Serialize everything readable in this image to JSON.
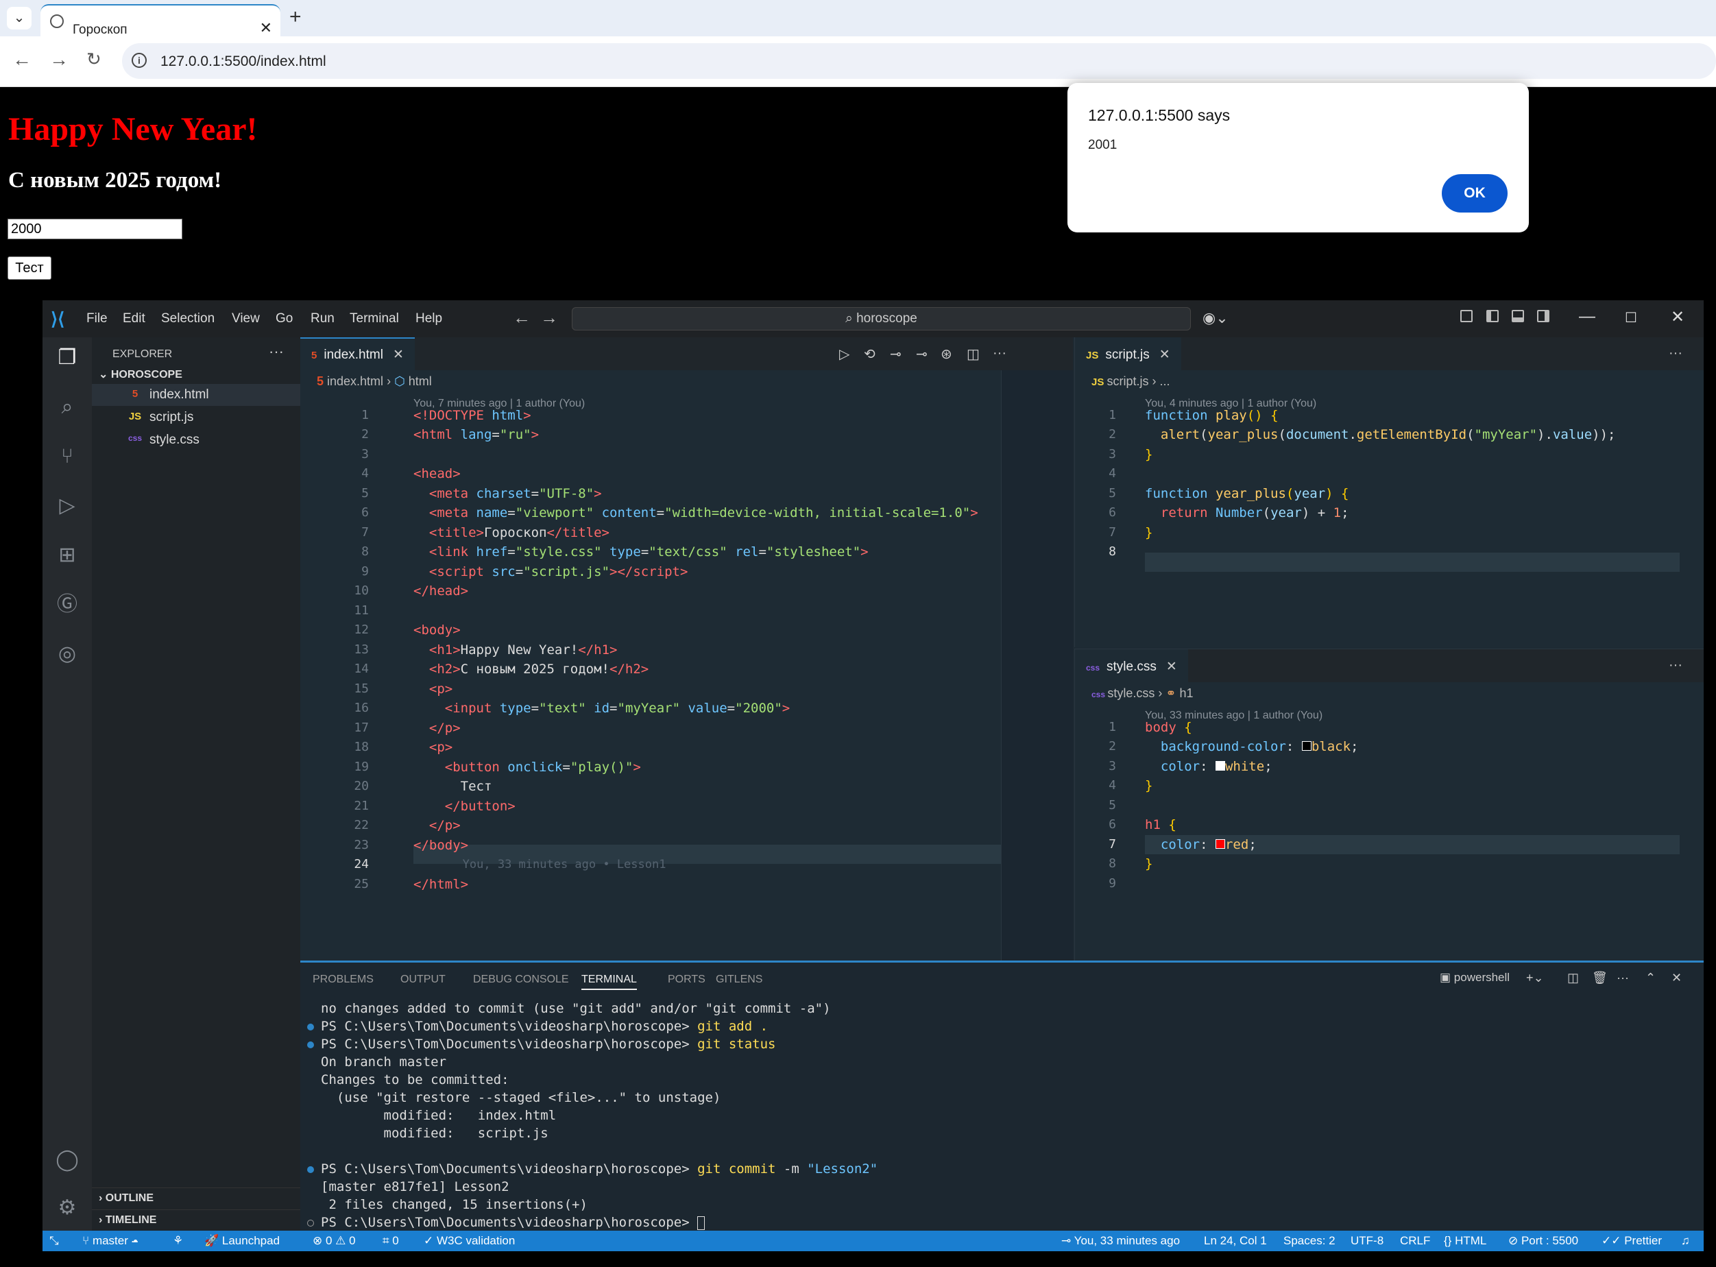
{
  "browser": {
    "tab_title": "Гороскоп",
    "url": "127.0.0.1:5500/index.html"
  },
  "page": {
    "h1": "Happy New Year!",
    "h2": "С новым 2025 годом!",
    "input_value": "2000",
    "button_label": "Тест"
  },
  "alert": {
    "header": "127.0.0.1:5500 says",
    "message": "2001",
    "ok": "OK"
  },
  "vscode": {
    "menu": [
      "File",
      "Edit",
      "Selection",
      "View",
      "Go",
      "Run",
      "Terminal",
      "Help"
    ],
    "search": "horoscope",
    "explorer": {
      "title": "EXPLORER",
      "folder": "HOROSCOPE",
      "files": [
        {
          "name": "index.html",
          "icon": "5",
          "color": "#e44d26"
        },
        {
          "name": "script.js",
          "icon": "JS",
          "color": "#f0d040"
        },
        {
          "name": "style.css",
          "icon": "css",
          "color": "#8a5ee0"
        }
      ],
      "outline": "OUTLINE",
      "timeline": "TIMELINE"
    },
    "html_editor": {
      "tab": "index.html",
      "crumb_file": "index.html",
      "crumb_node": "html",
      "blame": "You, 7 minutes ago | 1 author (You)",
      "inline_blame": "You, 33 minutes ago • Lesson1"
    },
    "js_editor": {
      "tab": "script.js",
      "crumb_file": "script.js",
      "crumb_rest": "...",
      "blame": "You, 4 minutes ago | 1 author (You)"
    },
    "css_editor": {
      "tab": "style.css",
      "crumb_file": "style.css",
      "crumb_node": "h1",
      "blame": "You, 33 minutes ago | 1 author (You)"
    },
    "panel": {
      "tabs": [
        "PROBLEMS",
        "OUTPUT",
        "DEBUG CONSOLE",
        "TERMINAL",
        "PORTS",
        "GITLENS"
      ],
      "shell": "powershell",
      "lines": [
        "no changes added to commit (use \"git add\" and/or \"git commit -a\")",
        "PS C:\\Users\\Tom\\Documents\\videosharp\\horoscope> ",
        "git add .",
        "PS C:\\Users\\Tom\\Documents\\videosharp\\horoscope> ",
        "git status",
        "On branch master",
        "Changes to be committed:",
        "  (use \"git restore --staged <file>...\" to unstage)",
        "        modified:   index.html",
        "        modified:   script.js",
        "PS C:\\Users\\Tom\\Documents\\videosharp\\horoscope> ",
        "git commit",
        " -m ",
        "\"Lesson2\"",
        "[master e817fe1] Lesson2",
        " 2 files changed, 15 insertions(+)",
        "PS C:\\Users\\Tom\\Documents\\videosharp\\horoscope> "
      ]
    },
    "status": {
      "branch": "master",
      "launchpad": "Launchpad",
      "errors": "0",
      "warnings": "0",
      "ports": "0",
      "w3c": "W3C validation",
      "blame": "You, 33 minutes ago",
      "cursor": "Ln 24, Col 1",
      "spaces": "Spaces: 2",
      "encoding": "UTF-8",
      "eol": "CRLF",
      "language": "HTML",
      "port": "Port : 5500",
      "prettier": "Prettier"
    }
  }
}
